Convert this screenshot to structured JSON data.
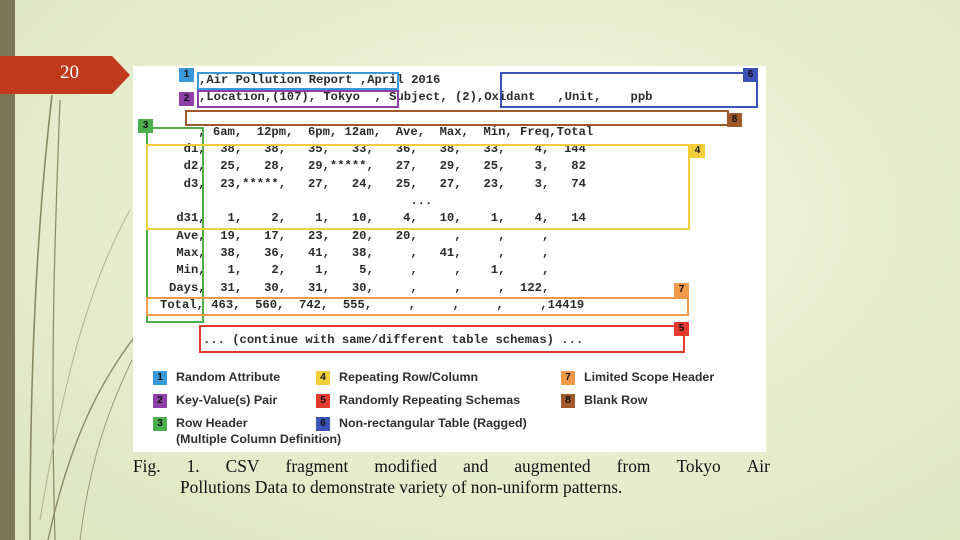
{
  "slide": {
    "number": "20"
  },
  "csv_lines": [
    ",Air Pollution Report ,April 2016",
    ",Location,(107), Tokyo  , Subject, (2),Oxidant   ,Unit,    ppb",
    "",
    "    , 6am,  12pm,  6pm, 12am,  Ave,  Max,  Min, Freq,Total",
    "  d1,  38,   38,   35,   33,   36,   38,   33,    4,  144",
    "  d2,  25,   28,   29,*****,   27,   29,   25,    3,   82",
    "  d3,  23,*****,   27,   24,   25,   27,   23,    3,   74",
    "                                 ...",
    " d31,   1,    2,    1,   10,    4,   10,    1,    4,   14",
    " Ave,  19,   17,   23,   20,   20,     ,     ,     ,",
    " Max,  38,   36,   41,   38,     ,   41,     ,     ,",
    " Min,   1,    2,    1,    5,     ,     ,    1,     ,",
    "Days,  31,   30,   31,   30,     ,     ,     ,  122,",
    "Total, 463,  560,  742,  555,     ,     ,     ,     ,14419",
    "",
    "   ... (continue with same/different table schemas) ..."
  ],
  "box_tags": [
    "1",
    "2",
    "3",
    "4",
    "5",
    "6",
    "7",
    "8"
  ],
  "legend": [
    {
      "num": "1",
      "label": "Random Attribute",
      "color": "#3a9ad9"
    },
    {
      "num": "2",
      "label": "Key-Value(s) Pair",
      "color": "#8e3fa8"
    },
    {
      "num": "3",
      "label": "Row Header",
      "sub": "(Multiple Column Definition)",
      "color": "#4cae4c"
    },
    {
      "num": "4",
      "label": "Repeating Row/Column",
      "color": "#f2cf3a"
    },
    {
      "num": "5",
      "label": "Randomly Repeating Schemas",
      "color": "#e23b2e"
    },
    {
      "num": "6",
      "label": "Non-rectangular Table (Ragged)",
      "color": "#3b52b8"
    },
    {
      "num": "7",
      "label": "Limited Scope Header",
      "color": "#f39a4a"
    },
    {
      "num": "8",
      "label": "Blank Row",
      "color": "#a0592a"
    }
  ],
  "caption": {
    "line1_words": [
      "Fig.",
      "1.",
      "CSV",
      "fragment",
      "modified",
      "and",
      "augmented",
      "from",
      "Tokyo",
      "Air"
    ],
    "line2": "Pollutions Data to demonstrate variety of non-uniform patterns."
  }
}
